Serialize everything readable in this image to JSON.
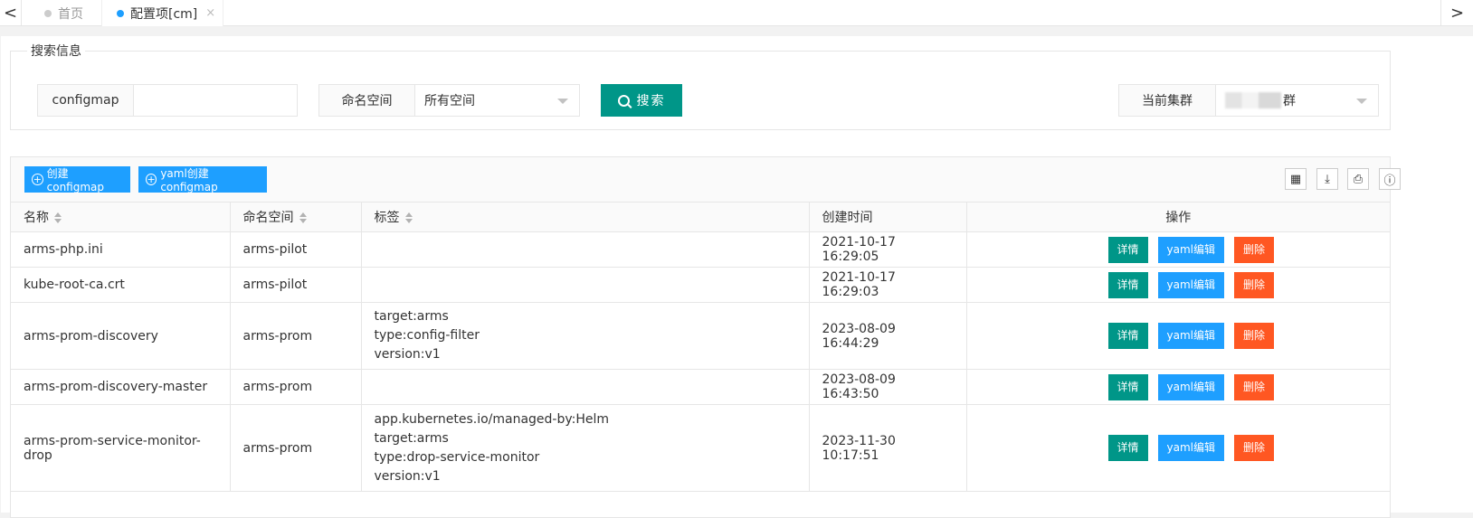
{
  "tabs": {
    "prev": "<",
    "next": ">",
    "home": "首页",
    "config": "配置项[cm]",
    "close": "×"
  },
  "search": {
    "legend": "搜索信息",
    "configmap_label": "configmap",
    "configmap_value": "",
    "namespace_label": "命名空间",
    "namespace_value": "所有空间",
    "search_button": "搜索",
    "cluster_label": "当前集群",
    "cluster_value": "群"
  },
  "toolbar": {
    "create_label": "创建configmap",
    "yaml_create_label": "yaml创建configmap",
    "icons": [
      "columns-icon",
      "export-icon",
      "print-icon",
      "info-icon"
    ]
  },
  "table": {
    "headers": [
      "名称",
      "命名空间",
      "标签",
      "创建时间",
      "操作"
    ],
    "actions": {
      "detail": "详情",
      "yaml": "yaml编辑",
      "delete": "删除"
    },
    "rows": [
      {
        "name": "arms-php.ini",
        "namespace": "arms-pilot",
        "labels": [],
        "created": "2021-10-17 16:29:05"
      },
      {
        "name": "kube-root-ca.crt",
        "namespace": "arms-pilot",
        "labels": [],
        "created": "2021-10-17 16:29:03"
      },
      {
        "name": "arms-prom-discovery",
        "namespace": "arms-prom",
        "labels": [
          "target:arms",
          "type:config-filter",
          "version:v1"
        ],
        "created": "2023-08-09 16:44:29"
      },
      {
        "name": "arms-prom-discovery-master",
        "namespace": "arms-prom",
        "labels": [],
        "created": "2023-08-09 16:43:50"
      },
      {
        "name": "arms-prom-service-monitor-drop",
        "namespace": "arms-prom",
        "labels": [
          "app.kubernetes.io/managed-by:Helm",
          "target:arms",
          "type:drop-service-monitor",
          "version:v1"
        ],
        "created": "2023-11-30 10:17:51"
      }
    ]
  },
  "colors": {
    "green": "#009688",
    "blue": "#1e9fff",
    "orange": "#ff5722"
  }
}
